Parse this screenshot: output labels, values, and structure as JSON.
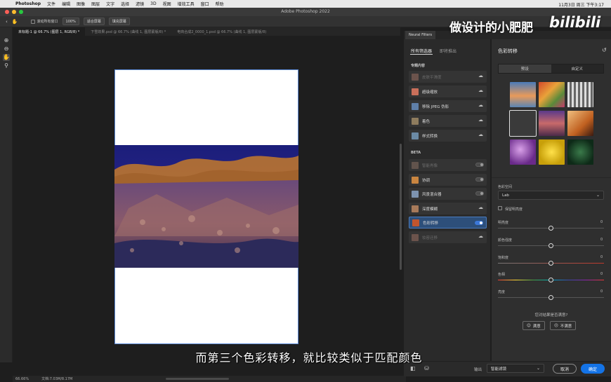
{
  "menubar": {
    "app": "Photoshop",
    "items": [
      "文件",
      "编辑",
      "图像",
      "图层",
      "文字",
      "选择",
      "滤镜",
      "3D",
      "视图",
      "增效工具",
      "窗口",
      "帮助"
    ],
    "clock": "11月3日 周三 下午3:17"
  },
  "window": {
    "title": "Adobe Photoshop 2022"
  },
  "options": {
    "scroll_all": "滚动所有窗口",
    "zoom": "100%",
    "fit_screen": "适合屏幕",
    "fill_screen": "填充屏幕"
  },
  "doc_tabs": [
    "未标题-1 @ 66.7% (图层 1, RGB/8) *",
    "下雪效果.psd @ 66.7% (曲线 1, 图层蒙版/8) *",
    "电商合成2_0000_1.psd @ 66.7% (曲线 1, 图层蒙版/8)"
  ],
  "status": {
    "zoom": "66.66%",
    "doc": "文档:7.03M/8.17M"
  },
  "subtitle": "而第三个色彩转移，就比较类似于匹配颜色",
  "watermark": {
    "text": "做设计的小肥肥",
    "logo": "bilibili"
  },
  "neural_filters": {
    "panel_tab": "Neural Filters",
    "category_tabs": [
      "所有筛选器",
      "即将推出"
    ],
    "featured_title": "专题内容",
    "featured": [
      {
        "label": "皮肤平滑度",
        "dim": true,
        "icon": "cloud-download-icon",
        "thumb": "#b07a6a"
      },
      {
        "label": "超级缩放",
        "dim": false,
        "icon": "cloud-download-icon",
        "thumb": "#c96f5a"
      },
      {
        "label": "移除 JPEG 伪影",
        "dim": false,
        "icon": "cloud-download-icon",
        "thumb": "#5f7fa8"
      },
      {
        "label": "着色",
        "dim": false,
        "icon": "cloud-download-icon",
        "thumb": "#8e7c5e"
      },
      {
        "label": "样式转换",
        "dim": false,
        "icon": "cloud-download-icon",
        "thumb": "#6b8aa5"
      }
    ],
    "beta_title": "BETA",
    "beta": [
      {
        "label": "智能肖像",
        "dim": true,
        "control": "toggle",
        "on": false,
        "thumb": "#9a7b6a"
      },
      {
        "label": "协调",
        "dim": false,
        "control": "toggle",
        "on": false,
        "thumb": "#c98540"
      },
      {
        "label": "风景混合器",
        "dim": false,
        "control": "toggle",
        "on": false,
        "thumb": "#7d93b0"
      },
      {
        "label": "深度模糊",
        "dim": false,
        "control": "cloud",
        "on": false,
        "thumb": "#a77a5a"
      },
      {
        "label": "色彩转移",
        "dim": false,
        "control": "toggle",
        "on": true,
        "thumb": "#c0552e"
      },
      {
        "label": "妆容迁移",
        "dim": true,
        "control": "cloud",
        "on": false,
        "thumb": "#b07a6a"
      }
    ],
    "detail": {
      "title": "色彩转移",
      "seg": [
        "预设",
        "自定义"
      ],
      "color_space_label": "色彩空间",
      "color_space_value": "Lab",
      "keep_luminance": "保留明亮度",
      "sliders": [
        {
          "label": "明亮度",
          "value": "0",
          "track": "#565656"
        },
        {
          "label": "颜色强度",
          "value": "0",
          "track": "#565656"
        },
        {
          "label": "饱和度",
          "value": "0",
          "track": "#c0392b"
        },
        {
          "label": "色相",
          "value": "0",
          "track": "hue"
        },
        {
          "label": "亮度",
          "value": "0",
          "track": "#565656"
        }
      ],
      "feedback_q": "您对结果是否满意?",
      "satisfied": "满意",
      "unsatisfied": "不满意"
    },
    "output_label": "输出",
    "output_value": "智能滤镜",
    "cancel": "取消",
    "ok": "确定"
  },
  "colors": {
    "accent": "#1473e6",
    "selected_row": "#2d4f7a",
    "artboard_border": "#5b8ad8"
  }
}
